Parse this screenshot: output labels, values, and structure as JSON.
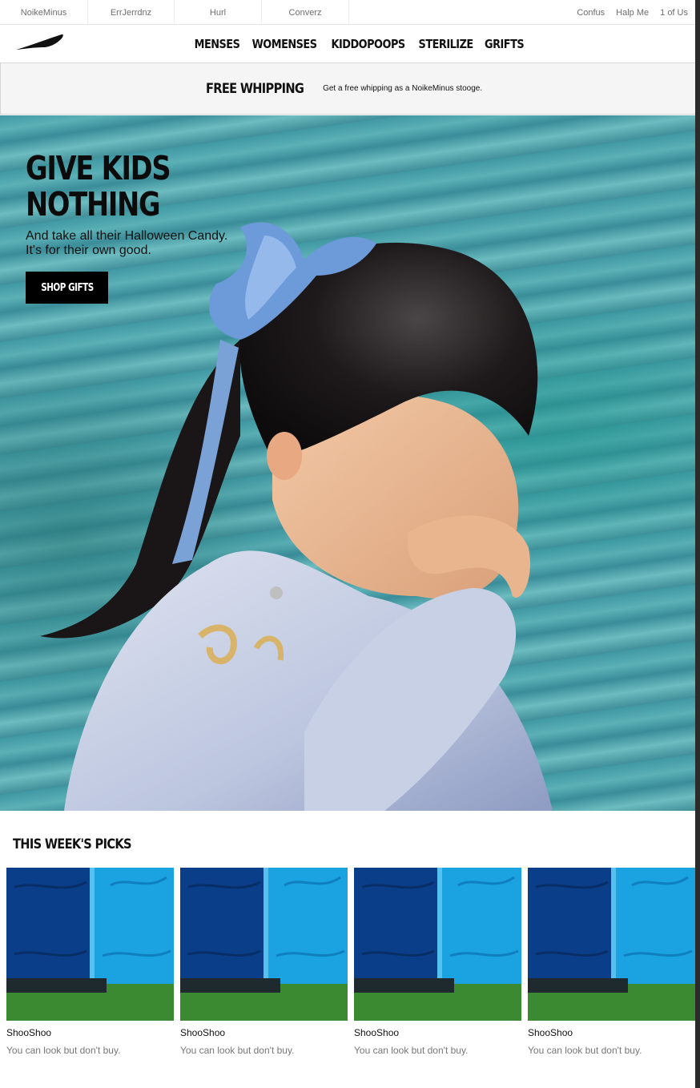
{
  "topbar": {
    "brands": [
      "NoikeMinus",
      "ErrJerrdnz",
      "Hurl",
      "Converz"
    ],
    "links": [
      "Confus",
      "Halp Me",
      "1 of Us"
    ]
  },
  "nav": {
    "logo_icon": "swoosh-logo-icon",
    "items": [
      "MENSES",
      "WOMENSES",
      "KIDDOPOOPS",
      "STERILIZE",
      "GRIFTS"
    ]
  },
  "promo": {
    "title": "FREE WHIPPING",
    "text": "Get a free whipping as a NoikeMinus stooge."
  },
  "hero": {
    "title_line1": "GIVE KIDS",
    "title_line2": "NOTHING",
    "subtitle": "And take all their Halloween Candy. It's for their own good.",
    "button": "SHOP GIFTS"
  },
  "picks": {
    "title": "THIS WEEK'S PICKS",
    "items": [
      {
        "name": "ShooShoo",
        "desc": "You can look but don't buy."
      },
      {
        "name": "ShooShoo",
        "desc": "You can look but don't buy."
      },
      {
        "name": "ShooShoo",
        "desc": "You can look but don't buy."
      },
      {
        "name": "ShooShoo",
        "desc": "You can look but don't buy."
      }
    ]
  },
  "colors": {
    "accent": "#000000",
    "hero_water": "#4aa0a8",
    "toilet_blue": "#1aa3e0",
    "toilet_dark": "#0b3e88",
    "grass": "#2f7a2a"
  }
}
